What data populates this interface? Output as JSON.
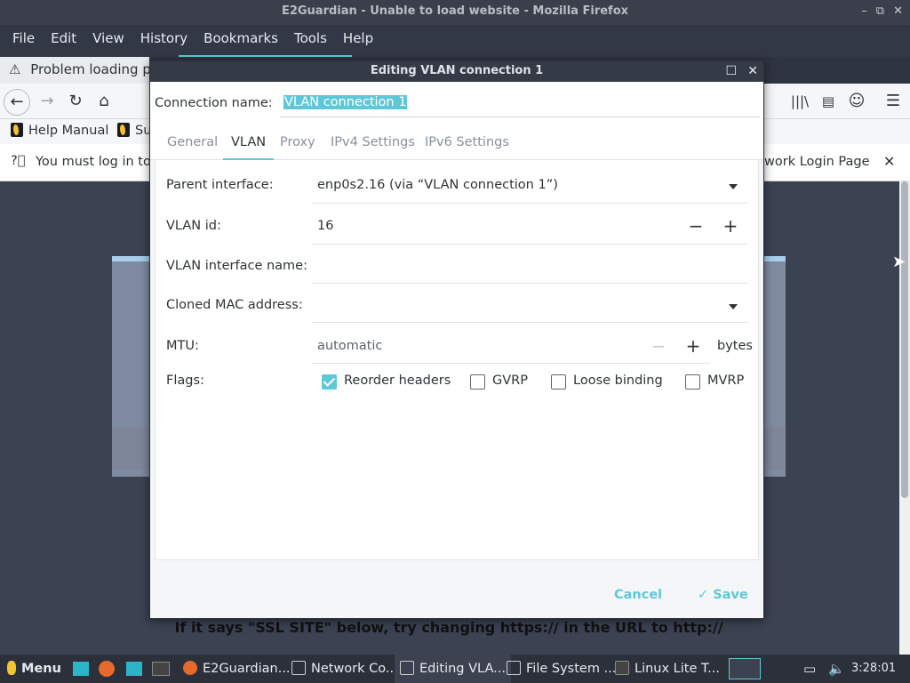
{
  "firefox": {
    "title": "E2Guardian - Unable to load website - Mozilla Firefox",
    "menu": [
      "File",
      "Edit",
      "View",
      "History",
      "Bookmarks",
      "Tools",
      "Help"
    ],
    "tab_title": "Problem loading pa",
    "bookmarks": [
      "Help Manual",
      "Su"
    ],
    "notification_left": "You must log in to",
    "notification_right": "work Login Page",
    "page_text": "If it says \"SSL SITE\" below, try changing https:// in the URL to http://"
  },
  "dialog": {
    "title": "Editing VLAN connection 1",
    "connection_name_label": "Connection name:",
    "connection_name_value": "VLAN connection 1",
    "tabs": [
      "General",
      "VLAN",
      "Proxy",
      "IPv4 Settings",
      "IPv6 Settings"
    ],
    "active_tab": "VLAN",
    "fields": {
      "parent_interface_label": "Parent interface:",
      "parent_interface_value": "enp0s2.16 (via “VLAN connection 1”)",
      "vlan_id_label": "VLAN id:",
      "vlan_id_value": "16",
      "vlan_iface_label": "VLAN interface name:",
      "vlan_iface_value": "",
      "cloned_mac_label": "Cloned MAC address:",
      "cloned_mac_value": "",
      "mtu_label": "MTU:",
      "mtu_value": "automatic",
      "mtu_unit": "bytes",
      "flags_label": "Flags:"
    },
    "flags": [
      {
        "label": "Reorder headers",
        "checked": true
      },
      {
        "label": "GVRP",
        "checked": false
      },
      {
        "label": "Loose binding",
        "checked": false
      },
      {
        "label": "MVRP",
        "checked": false
      }
    ],
    "cancel_label": "Cancel",
    "save_label": "✓ Save"
  },
  "taskbar": {
    "menu_label": "Menu",
    "items": [
      "E2Guardian...",
      "Network Co...",
      "Editing VLA...",
      "File System ...",
      "Linux Lite T..."
    ],
    "clock": "3:28:01 pm"
  },
  "colors": {
    "accent": "#5ec8d8",
    "panel_dark": "#2b303b"
  }
}
